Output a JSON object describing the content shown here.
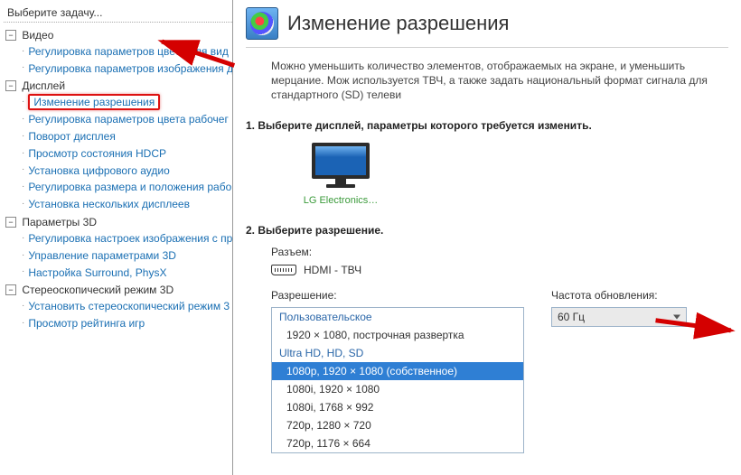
{
  "sidebar": {
    "header": "Выберите задачу...",
    "tree": {
      "video": {
        "label": "Видео",
        "children": [
          "Регулировка параметров цвета для вид",
          "Регулировка параметров изображения д"
        ]
      },
      "display": {
        "label": "Дисплей",
        "children": [
          "Изменение разрешения",
          "Регулировка параметров цвета рабочег",
          "Поворот дисплея",
          "Просмотр состояния HDCP",
          "Установка цифрового аудио",
          "Регулировка размера и положения рабо",
          "Установка нескольких дисплеев"
        ],
        "selected_index": 0
      },
      "params3d": {
        "label": "Параметры 3D",
        "children": [
          "Регулировка настроек изображения с пр",
          "Управление параметрами 3D",
          "Настройка Surround, PhysX"
        ]
      },
      "stereo3d": {
        "label": "Стереоскопический режим 3D",
        "children": [
          "Установить стереоскопический режим 3",
          "Просмотр рейтинга игр"
        ]
      }
    }
  },
  "main": {
    "title": "Изменение разрешения",
    "intro": "Можно уменьшить количество элементов, отображаемых на экране, и уменьшить мерцание. Мож используется ТВЧ, а также задать национальный формат сигнала для стандартного (SD) телеви",
    "section1": "1. Выберите дисплей, параметры которого требуется изменить.",
    "monitor_caption": "LG Electronics…",
    "section2": "2. Выберите разрешение.",
    "connector_label": "Разъем:",
    "connector_value": "HDMI - ТВЧ",
    "resolution_label": "Разрешение:",
    "resolution_list": {
      "groups": [
        {
          "label": "Пользовательское",
          "items": [
            "1920 × 1080, построчная развертка"
          ]
        },
        {
          "label": "Ultra HD, HD, SD",
          "items": [
            "1080p, 1920 × 1080 (собственное)",
            "1080i, 1920 × 1080",
            "1080i, 1768 × 992",
            "720p, 1280 × 720",
            "720p, 1176 × 664"
          ]
        }
      ],
      "selected": "1080p, 1920 × 1080 (собственное)"
    },
    "refresh_label": "Частота обновления:",
    "refresh_value": "60 Гц"
  }
}
